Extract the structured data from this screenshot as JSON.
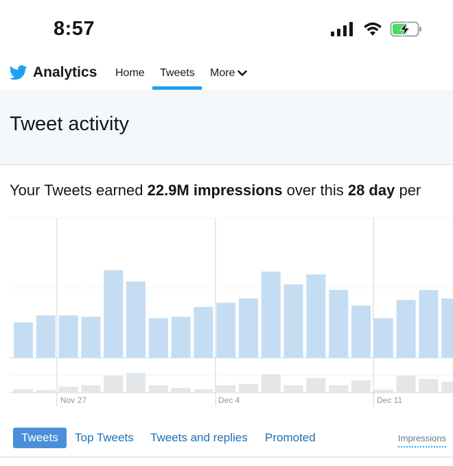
{
  "status_bar": {
    "time": "8:57",
    "icons": [
      "signal-icon",
      "wifi-icon",
      "battery-charging-icon"
    ]
  },
  "nav": {
    "brand": "Analytics",
    "brand_icon": "twitter-bird-icon",
    "items": [
      {
        "label": "Home"
      },
      {
        "label": "Tweets",
        "active": true
      },
      {
        "label": "More"
      }
    ]
  },
  "header": {
    "title": "Tweet activity"
  },
  "summary": {
    "prefix": "Your Tweets earned ",
    "impressions": "22.9M impressions",
    "middle": " over this ",
    "period": "28 day",
    "suffix": " per"
  },
  "chart_data": {
    "type": "bar",
    "date_labels": [
      "Nov 27",
      "Dec 4",
      "Dec 11"
    ],
    "series": [
      {
        "values": [
          0.25,
          0.3,
          0.3,
          0.29,
          0.62,
          0.54,
          0.28,
          0.29,
          0.36,
          0.39,
          0.42,
          0.61,
          0.52,
          0.59,
          0.48,
          0.37,
          0.28,
          0.41,
          0.48,
          0.42
        ]
      },
      {
        "values": [
          0.13,
          0.09,
          0.22,
          0.27,
          0.63,
          0.72,
          0.27,
          0.17,
          0.13,
          0.27,
          0.31,
          0.67,
          0.27,
          0.53,
          0.27,
          0.45,
          0.11,
          0.63,
          0.5,
          0.4
        ]
      }
    ],
    "colors": {
      "impressions": "#c4ddf3",
      "engagement": "#e3e7ea"
    }
  },
  "tabs": {
    "items": [
      {
        "label": "Tweets",
        "active": true
      },
      {
        "label": "Top Tweets"
      },
      {
        "label": "Tweets and replies"
      },
      {
        "label": "Promoted"
      }
    ],
    "metric": "Impressions"
  },
  "colors": {
    "accent": "#1da1f2",
    "text": "#14171a",
    "link": "#1b6fb5"
  }
}
